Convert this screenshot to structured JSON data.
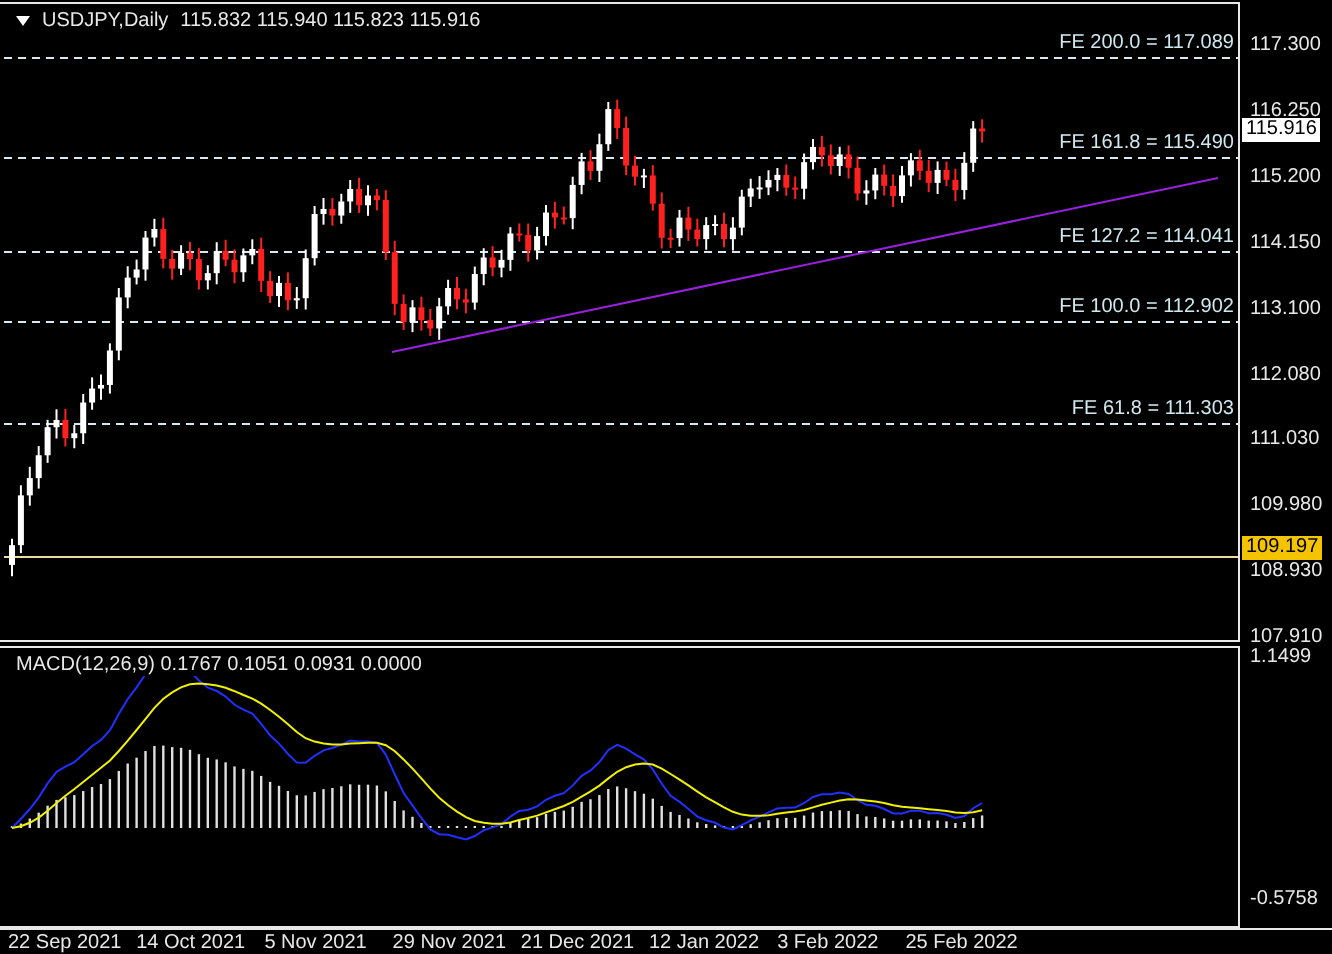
{
  "chart": {
    "symbol": "USDJPY,Daily",
    "quote": [
      "115.832",
      "115.940",
      "115.823",
      "115.916"
    ]
  },
  "fibonacci_levels": [
    {
      "label": "FE 200.0 = 117.089"
    },
    {
      "label": "FE 161.8 = 115.490"
    },
    {
      "label": "FE 127.2 = 114.041"
    },
    {
      "label": "FE 100.0 = 112.902"
    },
    {
      "label": "FE 61.8 = 111.303"
    }
  ],
  "price_axis": {
    "ticks": [
      "117.300",
      "116.250",
      "115.200",
      "114.150",
      "113.100",
      "112.080",
      "111.030",
      "109.980",
      "108.930",
      "107.910"
    ],
    "current_price": "115.916",
    "marked_price": "109.197"
  },
  "macd": {
    "label": "MACD(12,26,9) 0.1767 0.1051 0.0931 0.0000",
    "ticks": [
      "1.1499",
      "-0.5758"
    ]
  },
  "time_axis": {
    "labels": [
      "22 Sep 2021",
      "14 Oct 2021",
      "5 Nov 2021",
      "29 Nov 2021",
      "21 Dec 2021",
      "12 Jan 2022",
      "3 Feb 2022",
      "25 Feb 2022"
    ]
  }
}
